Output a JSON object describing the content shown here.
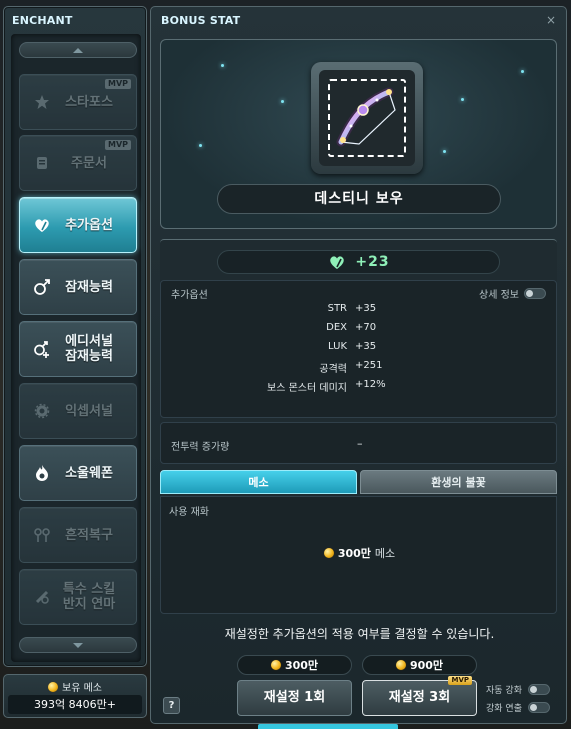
{
  "enchant": {
    "title": "ENCHANT",
    "menu": [
      {
        "label": "스타포스",
        "icon": "star-icon",
        "mvp": "MVP",
        "state": "disabled"
      },
      {
        "label": "주문서",
        "icon": "scroll-icon",
        "mvp": "MVP",
        "state": "disabled"
      },
      {
        "label": "추가옵션",
        "icon": "heart-leaf-icon",
        "mvp": "",
        "state": "active"
      },
      {
        "label": "잠재능력",
        "icon": "potential-icon",
        "mvp": "",
        "state": "normal"
      },
      {
        "label": "에디셔널\n잠재능력",
        "icon": "additional-potential-icon",
        "mvp": "",
        "state": "normal"
      },
      {
        "label": "익셉셔널",
        "icon": "gear-icon",
        "mvp": "",
        "state": "disabled"
      },
      {
        "label": "소울웨폰",
        "icon": "flame-icon",
        "mvp": "",
        "state": "normal"
      },
      {
        "label": "흔적복구",
        "icon": "trace-icon",
        "mvp": "",
        "state": "disabled"
      },
      {
        "label": "특수 스킬\n반지 연마",
        "icon": "ring-icon",
        "mvp": "",
        "state": "disabled"
      }
    ]
  },
  "meso_held": {
    "label": "보유 메소",
    "value": "393억 8406만+"
  },
  "bonus_stat": {
    "title": "BONUS STAT",
    "close": "×",
    "item_name": "데스티니 보우",
    "level": "+23",
    "stats_title": "추가옵션",
    "detail_label": "상세 정보",
    "stats": [
      {
        "name": "STR",
        "value": "+35"
      },
      {
        "name": "DEX",
        "value": "+70"
      },
      {
        "name": "LUK",
        "value": "+35"
      },
      {
        "name": "공격력",
        "value": "+251"
      },
      {
        "name": "보스 몬스터 데미지",
        "value": "+12%"
      }
    ],
    "power_label": "전투력 증가량",
    "power_value": "–",
    "tabs": [
      "메소",
      "환생의 불꽃"
    ],
    "cost_title": "사용 재화",
    "cost_amount": "300만",
    "cost_unit": "메소",
    "notice": "재설정한 추가옵션의 적용 여부를 결정할 수 있습니다.",
    "price_1": "300만",
    "price_3": "900만",
    "reset_1": "재설정 1회",
    "reset_3": "재설정 3회",
    "mvp_badge": "MVP",
    "help": "?",
    "auto_enhance": "자동 강화",
    "enhance_chain": "강화 연출"
  },
  "colors": {
    "accent": "#35c6df",
    "level_text": "#8ff0b8",
    "panel_bg": "#1f2b30"
  }
}
